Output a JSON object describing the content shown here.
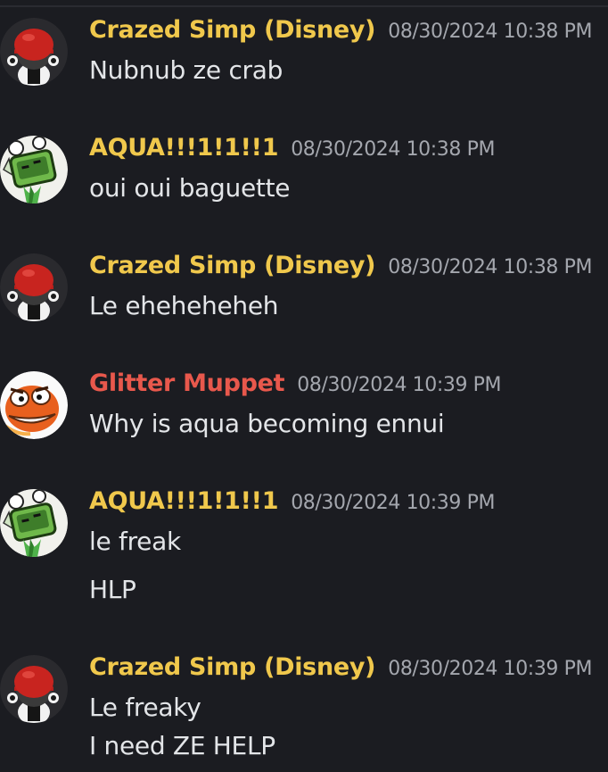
{
  "colors": {
    "background": "#1b1c21",
    "yellow_name": "#f0c84c",
    "red_name": "#e8584c",
    "timestamp": "#a4a7ae",
    "message_text": "#e3e5e8"
  },
  "messages": [
    {
      "username": "Crazed Simp (Disney)",
      "name_color": "#f0c84c",
      "timestamp": "08/30/2024 10:38 PM",
      "avatar_icon": "red-helmet-avatar-icon",
      "lines": [
        "Nubnub ze crab"
      ]
    },
    {
      "username": "AQUA!!!1!1!!1",
      "name_color": "#f0c84c",
      "timestamp": "08/30/2024 10:38 PM",
      "avatar_icon": "green-robot-avatar-icon",
      "lines": [
        "oui oui baguette"
      ]
    },
    {
      "username": "Crazed Simp (Disney)",
      "name_color": "#f0c84c",
      "timestamp": "08/30/2024 10:38 PM",
      "avatar_icon": "red-helmet-avatar-icon",
      "lines": [
        "Le eheheheheh"
      ]
    },
    {
      "username": "Glitter Muppet",
      "name_color": "#e8584c",
      "timestamp": "08/30/2024 10:39 PM",
      "avatar_icon": "orange-muppet-avatar-icon",
      "lines": [
        "Why is aqua becoming ennui"
      ]
    },
    {
      "username": "AQUA!!!1!1!!1",
      "name_color": "#f0c84c",
      "timestamp": "08/30/2024 10:39 PM",
      "avatar_icon": "green-robot-avatar-icon",
      "lines": [
        "le freak",
        "HLP"
      ]
    },
    {
      "username": "Crazed Simp (Disney)",
      "name_color": "#f0c84c",
      "timestamp": "08/30/2024 10:39 PM",
      "avatar_icon": "red-helmet-avatar-icon",
      "lines": [
        "Le freaky",
        "I need ZE HELP"
      ]
    }
  ]
}
